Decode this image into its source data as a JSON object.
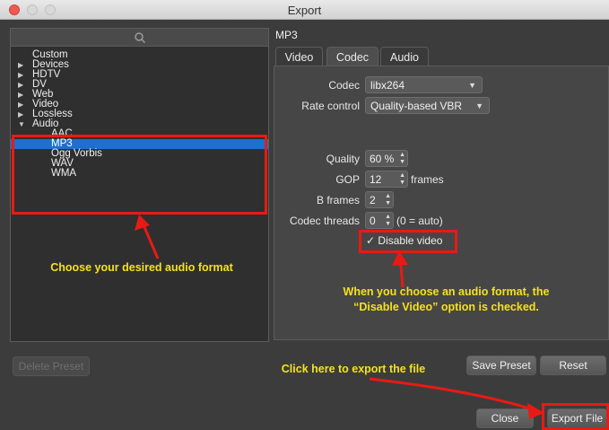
{
  "window": {
    "title": "Export"
  },
  "search": {
    "icon": "search-icon"
  },
  "tree": {
    "items": [
      {
        "label": "Custom",
        "expander": ""
      },
      {
        "label": "Devices",
        "expander": "▶"
      },
      {
        "label": "HDTV",
        "expander": "▶"
      },
      {
        "label": "DV",
        "expander": "▶"
      },
      {
        "label": "Web",
        "expander": "▶"
      },
      {
        "label": "Video",
        "expander": "▶"
      },
      {
        "label": "Lossless",
        "expander": "▶"
      },
      {
        "label": "Audio",
        "expander": "▼"
      },
      {
        "label": "AAC",
        "child": true
      },
      {
        "label": "MP3",
        "child": true,
        "selected": true
      },
      {
        "label": "Ogg Vorbis",
        "child": true
      },
      {
        "label": "WAV",
        "child": true
      },
      {
        "label": "WMA",
        "child": true
      }
    ]
  },
  "preset": {
    "name": "MP3"
  },
  "tabs": [
    {
      "label": "Video"
    },
    {
      "label": "Codec",
      "active": true
    },
    {
      "label": "Audio"
    }
  ],
  "codec": {
    "codec_label": "Codec",
    "codec_value": "libx264",
    "rate_control_label": "Rate control",
    "rate_control_value": "Quality-based VBR",
    "quality_label": "Quality",
    "quality_value": "60 %",
    "gop_label": "GOP",
    "gop_value": "12",
    "gop_suffix": "frames",
    "bframes_label": "B frames",
    "bframes_value": "2",
    "threads_label": "Codec threads",
    "threads_value": "0",
    "threads_suffix": "(0 = auto)",
    "disable_video_label": "Disable video",
    "disable_video_checked": true
  },
  "buttons": {
    "delete_preset": "Delete Preset",
    "save_preset": "Save Preset",
    "reset": "Reset",
    "close": "Close",
    "export_file": "Export File"
  },
  "annotations": {
    "choose_format": "Choose your desired audio format",
    "disable_video_note_1": "When you choose an audio format, the",
    "disable_video_note_2": "“Disable Video” option is checked.",
    "export_note": "Click here to export the file"
  },
  "colors": {
    "selection": "#1f6fd0",
    "highlight_box": "#e81a14",
    "annotation_text": "#f5e21b"
  }
}
